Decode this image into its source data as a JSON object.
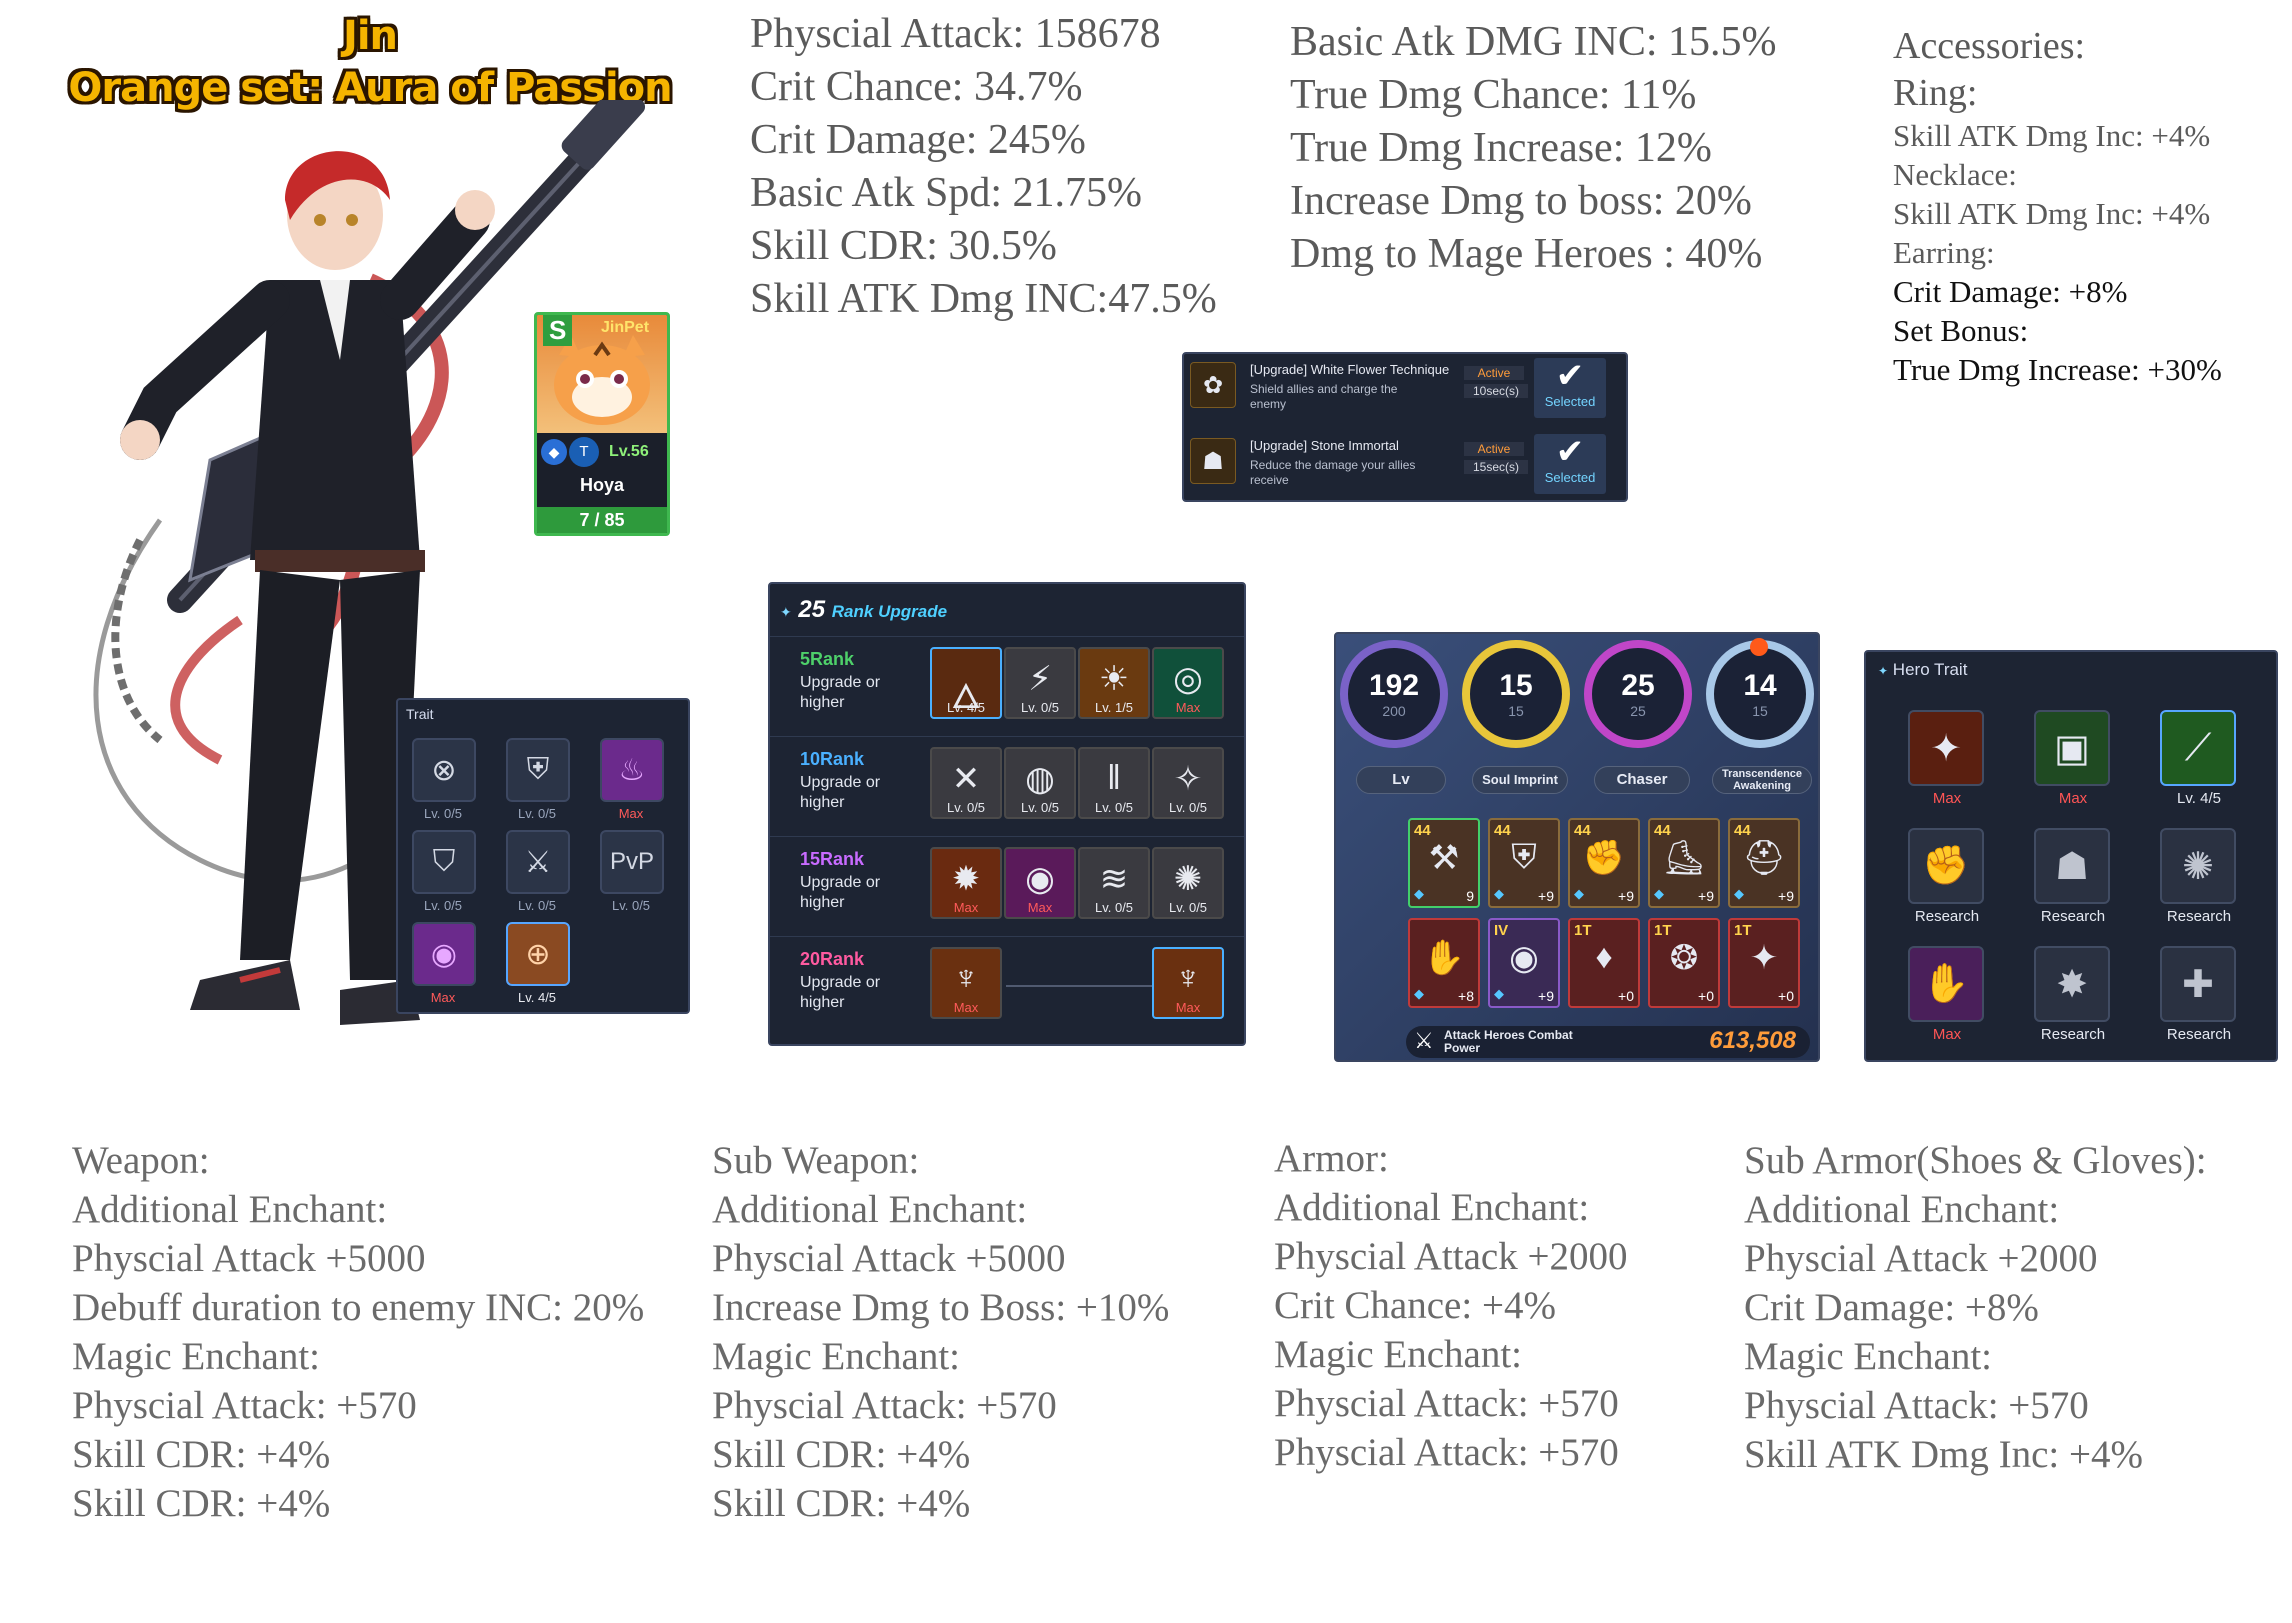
{
  "header": {
    "name": "Jin",
    "set": "Orange set: Aura of Passion"
  },
  "stats_col1": [
    "Physcial Attack: 158678",
    "Crit Chance: 34.7%",
    "Crit Damage: 245%",
    "Basic Atk Spd: 21.75%",
    "Skill CDR: 30.5%",
    "Skill ATK Dmg INC:47.5%"
  ],
  "stats_col2": [
    "Basic Atk DMG INC: 15.5%",
    "True Dmg Chance: 11%",
    "True Dmg Increase: 12%",
    "Increase Dmg to boss: 20%",
    "Dmg to Mage Heroes : 40%"
  ],
  "accessories": {
    "title": "Accessories:",
    "ring_label": "Ring:",
    "ring_value": "Skill ATK Dmg Inc: +4%",
    "necklace_label": "Necklace:",
    "necklace_value": "Skill ATK Dmg Inc: +4%",
    "earring_label": "Earring:",
    "earring_value": "Crit Damage: +8%",
    "set_label": "Set Bonus:",
    "set_value": "True Dmg Increase: +30%"
  },
  "pet": {
    "grade": "S",
    "name_tag": "JinPet",
    "level": "Lv.56",
    "name": "Hoya",
    "count": "7 / 85"
  },
  "skills": [
    {
      "name": "[Upgrade] White Flower Technique",
      "desc": "Shield allies and charge the enemy",
      "status": "Active",
      "cooldown": "10sec(s)",
      "button": "Selected",
      "rank": "1"
    },
    {
      "name": "[Upgrade] Stone Immortal",
      "desc": "Reduce the damage your allies receive",
      "status": "Active",
      "cooldown": "15sec(s)",
      "button": "Selected",
      "rank": "1"
    }
  ],
  "trait": {
    "title": "Trait",
    "labels": [
      "Lv. 0/5",
      "Lv. 0/5",
      "Max",
      "Lv. 0/5",
      "Lv. 0/5",
      "Lv. 0/5",
      "Max",
      "Lv. 4/5"
    ],
    "icons": [
      "crosshair-shield-icon",
      "fist-shield-icon",
      "flame-icon",
      "shield-icon",
      "pvp-sword-icon",
      "pvp-badge-icon",
      "vortex-icon",
      "target-icon"
    ]
  },
  "rank_upgrade": {
    "count": "25",
    "title": "Rank Upgrade",
    "rows": [
      {
        "rank": "5Rank",
        "sub": "Upgrade or higher",
        "color": "#4ed06a",
        "labels": [
          "Lv. 4/5",
          "Lv. 0/5",
          "Lv. 1/5",
          "Max"
        ]
      },
      {
        "rank": "10Rank",
        "sub": "Upgrade or higher",
        "color": "#4ab0ff",
        "labels": [
          "Lv. 0/5",
          "Lv. 0/5",
          "Lv. 0/5",
          "Lv. 0/5"
        ]
      },
      {
        "rank": "15Rank",
        "sub": "Upgrade or higher",
        "color": "#c86bff",
        "labels": [
          "Max",
          "Max",
          "Lv. 0/5",
          "Lv. 0/5"
        ]
      },
      {
        "rank": "20Rank",
        "sub": "Upgrade or higher",
        "color": "#ff5aa0",
        "labels": [
          "Max",
          "Max"
        ]
      }
    ]
  },
  "equipment_panel": {
    "circles": [
      {
        "value": "192",
        "max": "200",
        "label": "Lv"
      },
      {
        "value": "15",
        "max": "15",
        "label": "Soul Imprint"
      },
      {
        "value": "25",
        "max": "25",
        "label": "Chaser"
      },
      {
        "value": "14",
        "max": "15",
        "label": "Transcendence Awakening"
      }
    ],
    "row1": [
      {
        "top": "44",
        "bottom": "9"
      },
      {
        "top": "44",
        "bottom": "+9"
      },
      {
        "top": "44",
        "bottom": "+9"
      },
      {
        "top": "44",
        "bottom": "+9"
      },
      {
        "top": "44",
        "bottom": "+9"
      }
    ],
    "row2": [
      {
        "top": "",
        "bottom": "+8"
      },
      {
        "top": "IV",
        "bottom": "+9"
      },
      {
        "top": "1T",
        "bottom": "+0"
      },
      {
        "top": "1T",
        "bottom": "+0"
      },
      {
        "top": "1T",
        "bottom": "+0"
      }
    ],
    "power_label": "Attack Heroes Combat Power",
    "power_value": "613,508"
  },
  "hero_trait": {
    "title": "Hero Trait",
    "labels": [
      "Max",
      "Max",
      "Lv. 4/5",
      "Research",
      "Research",
      "Research",
      "Max",
      "Research",
      "Research"
    ]
  },
  "weapon": [
    "Weapon:",
    "Additional Enchant:",
    "Physcial Attack +5000",
    "Debuff duration to enemy INC: 20%",
    "Magic Enchant:",
    "Physcial Attack: +570",
    "Skill CDR: +4%",
    "Skill CDR: +4%"
  ],
  "sub_weapon": [
    "Sub Weapon:",
    "Additional Enchant:",
    "Physcial Attack +5000",
    "Increase Dmg to Boss: +10%",
    "Magic Enchant:",
    "Physcial Attack: +570",
    "Skill CDR: +4%",
    "Skill CDR: +4%"
  ],
  "armor": [
    "Armor:",
    "Additional Enchant:",
    "Physcial Attack +2000",
    "Crit Chance: +4%",
    "Magic Enchant:",
    "Physcial Attack: +570",
    "Physcial Attack: +570"
  ],
  "sub_armor": [
    "Sub Armor(Shoes & Gloves):",
    "Additional Enchant:",
    "Physcial Attack +2000",
    "Crit Damage: +8%",
    "Magic Enchant:",
    "Physcial Attack: +570",
    "Skill ATK Dmg Inc: +4%"
  ]
}
